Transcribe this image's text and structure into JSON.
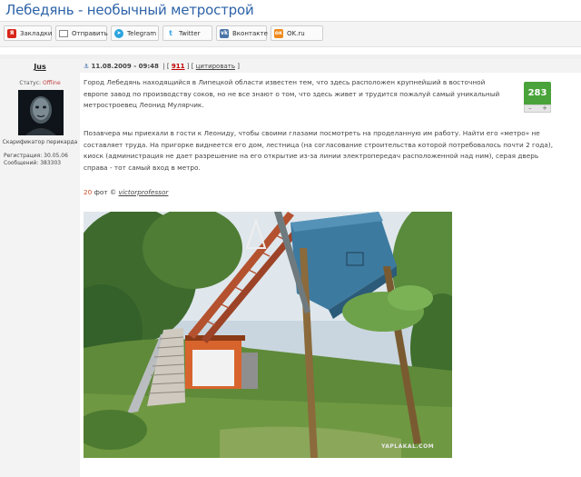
{
  "header": {
    "title": "Лебедянь - необычный метрострой"
  },
  "share": {
    "bookmarks": {
      "label": "Закладки",
      "icon": "yandex-bookmarks-icon"
    },
    "send": {
      "label": "Отправить",
      "icon": "envelope-icon"
    },
    "telegram": {
      "label": "Telegram",
      "icon": "telegram-icon"
    },
    "twitter": {
      "label": "Twitter",
      "icon": "twitter-icon"
    },
    "vkontakte": {
      "label": "Вконтакте",
      "icon": "vk-icon"
    },
    "okru": {
      "label": "OK.ru",
      "icon": "odnoklassniki-icon"
    }
  },
  "user": {
    "name": "Jus",
    "status_label": "Статус:",
    "status_value": "Offline",
    "role": "Скарификатор перикарда",
    "registration": "Регистрация: 30.05.06",
    "messages": "Сообщений: 383303"
  },
  "post": {
    "datetime": "11.08.2009 - 09:48",
    "comments_count": "911",
    "quote_label": "цитировать",
    "rating": "283",
    "paragraph1": "Город Лебедянь находящийся в Липецкой области известен тем, что здесь расположен крупнейший в восточной европе завод по производству соков, но не все знают о том, что здесь живет и трудится пожалуй самый уникальный метростроевец Леонид Мулярчик.",
    "paragraph2": "Позавчера мы приехали в гости к Леониду, чтобы своими глазами посмотреть на проделанную им работу. Найти его «метро» не составляет труда. На пригорке виднеется его дом, лестница (на согласование строительства которой потребовалось почти 2 года), киоск (администрация не дает разрешение на его открытие из-за линии электропередач расположенной над ним), серая дверь справа - тот самый вход в метро.",
    "photos_count": "20",
    "photos_word": "фот ©",
    "photos_author": "victorprofessor",
    "watermark": "YAPLAKAL.COM"
  },
  "colors": {
    "title": "#2d63a8",
    "rating_bg": "#4aa33a",
    "accent_red": "#c00000",
    "photo_count": "#d04e2b"
  }
}
